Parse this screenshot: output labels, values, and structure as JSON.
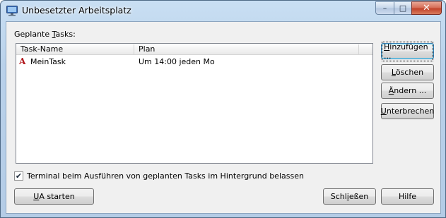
{
  "window": {
    "title": "Unbesetzter Arbeitsplatz",
    "icon": "monitor-icon",
    "caption_buttons": {
      "minimize": "–",
      "maximize": "□",
      "close": "✕"
    }
  },
  "tasks_label": {
    "pre": "Geplante ",
    "accel": "T",
    "post": "asks:"
  },
  "list": {
    "columns": [
      "Task-Name",
      "Plan"
    ],
    "rows": [
      {
        "icon": "A",
        "name": "MeinTask",
        "plan": "Um 14:00 jeden Mo"
      }
    ]
  },
  "buttons": {
    "add": {
      "accel": "H",
      "rest": "inzufügen ..."
    },
    "delete": {
      "accel": "L",
      "rest": "öschen"
    },
    "change": {
      "accel": "Ä",
      "rest": "ndern ..."
    },
    "interrupt": {
      "accel": "U",
      "rest": "nterbrechen"
    },
    "start": {
      "accel": "U",
      "rest": "A starten"
    },
    "close": {
      "pre": "Schl",
      "accel": "i",
      "rest": "eßen"
    },
    "help": {
      "label": "Hilfe"
    }
  },
  "checkbox": {
    "checked": true,
    "mark": "✔",
    "label": "Terminal beim Ausführen von geplanten Tasks im Hintergrund belassen"
  }
}
